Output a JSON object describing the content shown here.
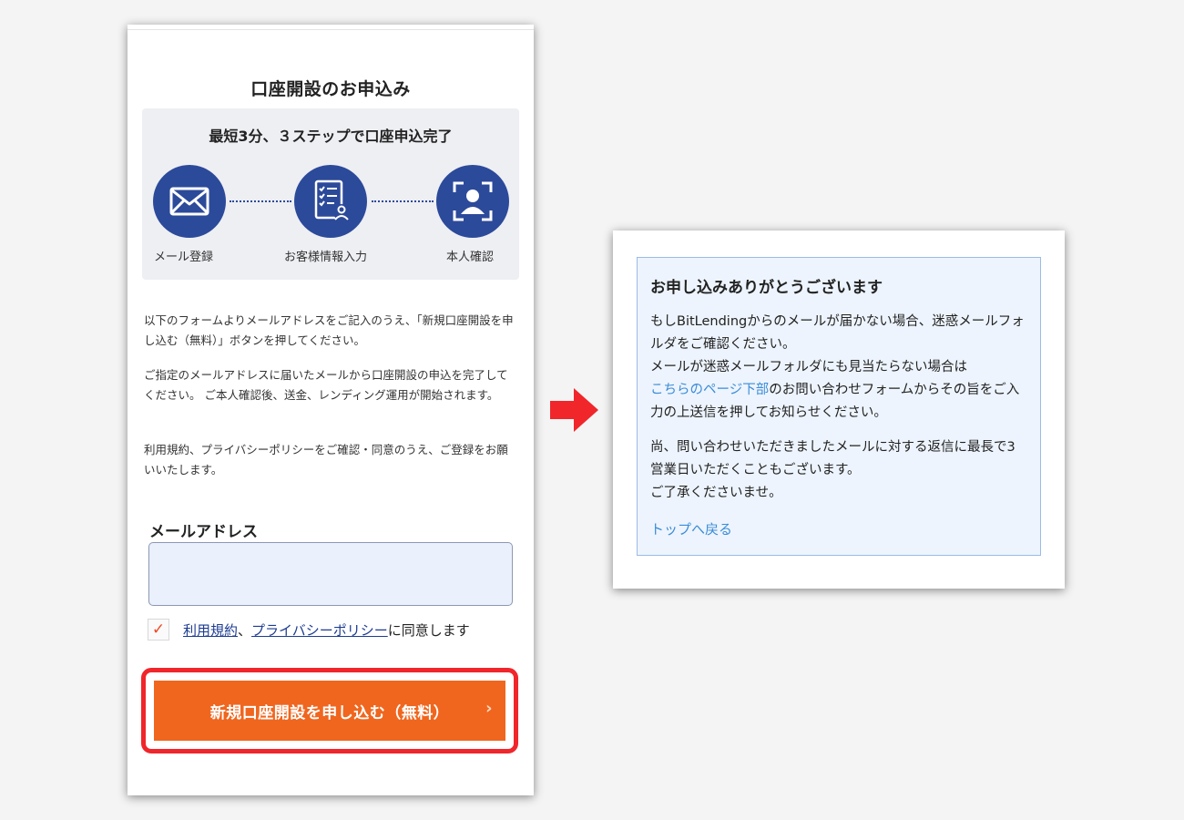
{
  "left": {
    "page_title": "口座開設のお申込み",
    "steps_heading": "最短3分、３ステップで口座申込完了",
    "steps": [
      {
        "label": "メール登録",
        "icon": "mail-icon"
      },
      {
        "label": "お客様情報入力",
        "icon": "form-checklist-icon"
      },
      {
        "label": "本人確認",
        "icon": "face-scan-icon"
      }
    ],
    "paragraphs": [
      "以下のフォームよりメールアドレスをご記入のうえ、「新規口座開設を申し込む（無料）」ボタンを押してください。",
      "ご指定のメールアドレスに届いたメールから口座開設の申込を完了してください。 ご本人確認後、送金、レンディング運用が開始されます。",
      "利用規約、プライバシーポリシーをご確認・同意のうえ、ご登録をお願いいたします。"
    ],
    "email_label": "メールアドレス",
    "email_value": "",
    "checkbox_mark": "✓",
    "agree": {
      "terms_link": "利用規約",
      "separator": "、",
      "privacy_link": "プライバシーポリシー",
      "suffix": "に同意します"
    },
    "submit_label": "新規口座開設を申し込む（無料）",
    "submit_chevron": "›"
  },
  "right": {
    "title": "お申し込みありがとうございます",
    "body_1_a": "もしBitLendingからのメールが届かない場合、迷惑メールフォルダをご確認ください。",
    "body_1_b": "メールが迷惑メールフォルダにも見当たらない場合は",
    "body_1_link": "こちらのページ下部",
    "body_1_c": "のお問い合わせフォームからその旨をご入力の上送信を押してお知らせください。",
    "body_2": "尚、問い合わせいただきましたメールに対する返信に最長で3営業日いただくこともございます。",
    "body_2_b": "ご了承くださいませ。",
    "back_link": "トップへ戻る"
  },
  "colors": {
    "step_circle": "#2c4a9a",
    "submit_button": "#f0661e",
    "highlight_border": "#f0262b",
    "arrow": "#f0262b",
    "link": "#3b8dd8",
    "notice_bg": "#edf4fd"
  }
}
